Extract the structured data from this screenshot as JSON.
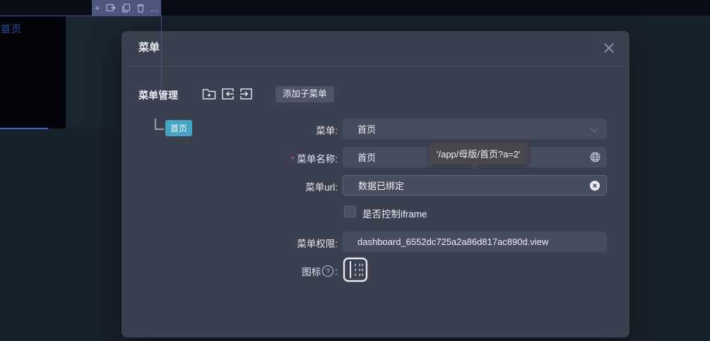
{
  "canvas": {
    "page_link": "首页"
  },
  "icons": {
    "plus": "+",
    "more": "..."
  },
  "modal": {
    "title": "菜单",
    "manage_label": "菜单管理",
    "add_submenu_button": "添加子菜单",
    "tree_node": "首页",
    "fields": {
      "menu_label": "菜单:",
      "menu_value": "首页",
      "name_required": "*",
      "name_label": "菜单名称:",
      "name_value": "首页",
      "url_tooltip": "'/app/母版/首页?a=2'",
      "url_label": "菜单url:",
      "url_value": "数据已绑定",
      "iframe_label": "是否控制iframe",
      "permission_label": "菜单权限:",
      "permission_value": "dashboard_6552dc725a2a86d817ac890d.view",
      "icon_label": "图标",
      "icon_help": "?",
      "icon_colon": ":"
    }
  },
  "colors": {
    "accent_blue": "#4460c5",
    "chip_teal": "#45a3c4",
    "required_red": "#e25656",
    "modal_bg": "#3b4051",
    "field_bg": "#474c5f"
  }
}
